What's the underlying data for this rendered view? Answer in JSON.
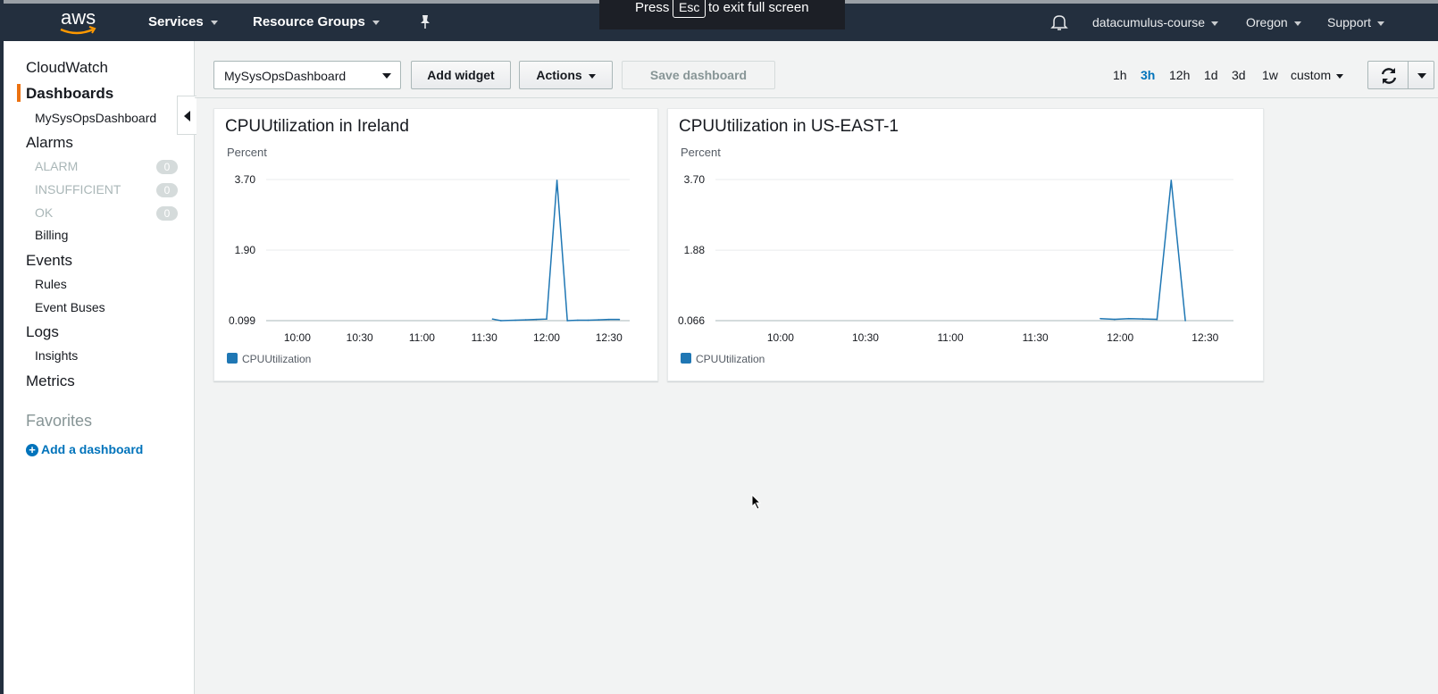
{
  "topnav": {
    "logo_text": "aws",
    "services": "Services",
    "resource_groups": "Resource Groups",
    "account": "datacumulus-course",
    "region": "Oregon",
    "support": "Support"
  },
  "fullscreen_notice": {
    "before": "Press",
    "key": "Esc",
    "after": "to exit full screen"
  },
  "sidebar": {
    "cloudwatch": "CloudWatch",
    "dashboards": "Dashboards",
    "dashboard_item": "MySysOpsDashboard",
    "alarms": "Alarms",
    "alarm_states": [
      {
        "label": "ALARM",
        "count": "0"
      },
      {
        "label": "INSUFFICIENT",
        "count": "0"
      },
      {
        "label": "OK",
        "count": "0"
      }
    ],
    "billing": "Billing",
    "events": "Events",
    "rules": "Rules",
    "event_buses": "Event Buses",
    "logs": "Logs",
    "insights": "Insights",
    "metrics": "Metrics",
    "favorites": "Favorites",
    "add_dashboard": "Add a dashboard"
  },
  "toolbar": {
    "dashboard_select": "MySysOpsDashboard",
    "add_widget": "Add widget",
    "actions": "Actions",
    "save_dashboard": "Save dashboard",
    "ranges": [
      "1h",
      "3h",
      "12h",
      "1d",
      "3d",
      "1w"
    ],
    "selected_range": "3h",
    "custom": "custom"
  },
  "colors": {
    "series": "#1f77b4",
    "accent_orange": "#ec7211",
    "link_blue": "#0073bb",
    "nav_bg": "#232f3e"
  },
  "chart_data": [
    {
      "type": "line",
      "title": "CPUUtilization in Ireland",
      "ylabel": "Percent",
      "y_ticks": [
        "3.70",
        "1.90",
        "0.099"
      ],
      "x_ticks": [
        "10:00",
        "10:30",
        "11:00",
        "11:30",
        "12:00",
        "12:30"
      ],
      "ylim": [
        0.099,
        3.7
      ],
      "series": [
        {
          "name": "CPUUtilization",
          "x": [
            "11:34",
            "11:38",
            "11:45",
            "11:50",
            "11:55",
            "12:00",
            "12:05",
            "12:10",
            "12:15",
            "12:20",
            "12:25",
            "12:30",
            "12:35"
          ],
          "values": [
            0.14,
            0.1,
            0.11,
            0.12,
            0.13,
            0.14,
            3.68,
            0.1,
            0.11,
            0.11,
            0.12,
            0.13,
            0.13
          ]
        }
      ],
      "legend": "bottom-left"
    },
    {
      "type": "line",
      "title": "CPUUtilization in US-EAST-1",
      "ylabel": "Percent",
      "y_ticks": [
        "3.70",
        "1.88",
        "0.066"
      ],
      "x_ticks": [
        "10:00",
        "10:30",
        "11:00",
        "11:30",
        "12:00",
        "12:30"
      ],
      "ylim": [
        0.066,
        3.7
      ],
      "series": [
        {
          "name": "CPUUtilization",
          "x": [
            "11:53",
            "11:58",
            "12:03",
            "12:08",
            "12:13",
            "12:18",
            "12:23"
          ],
          "values": [
            0.12,
            0.1,
            0.12,
            0.11,
            0.1,
            3.68,
            0.066
          ]
        }
      ],
      "legend": "bottom-left"
    }
  ]
}
